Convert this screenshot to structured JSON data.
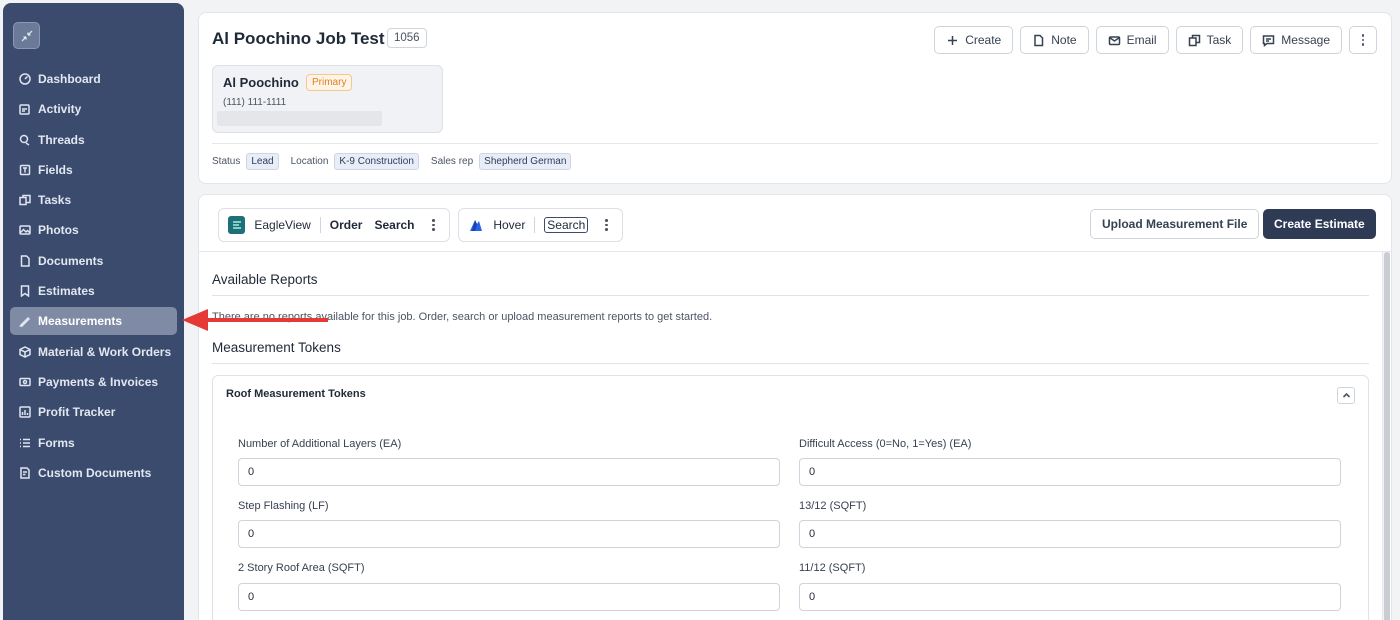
{
  "sidebar": {
    "items": [
      {
        "label": "Dashboard",
        "icon": "gauge-icon"
      },
      {
        "label": "Activity",
        "icon": "activity-icon"
      },
      {
        "label": "Threads",
        "icon": "threads-icon"
      },
      {
        "label": "Fields",
        "icon": "fields-icon"
      },
      {
        "label": "Tasks",
        "icon": "tasks-icon"
      },
      {
        "label": "Photos",
        "icon": "photo-icon"
      },
      {
        "label": "Documents",
        "icon": "document-icon"
      },
      {
        "label": "Estimates",
        "icon": "estimate-icon"
      },
      {
        "label": "Measurements",
        "icon": "ruler-icon",
        "active": true
      },
      {
        "label": "Material & Work Orders",
        "icon": "box-icon"
      },
      {
        "label": "Payments & Invoices",
        "icon": "payment-icon"
      },
      {
        "label": "Profit Tracker",
        "icon": "chart-icon"
      },
      {
        "label": "Forms",
        "icon": "list-icon"
      },
      {
        "label": "Custom Documents",
        "icon": "custom-doc-icon"
      }
    ]
  },
  "header": {
    "title": "Al Poochino Job Test",
    "job_number": "1056",
    "actions": {
      "create": "Create",
      "note": "Note",
      "email": "Email",
      "task": "Task",
      "message": "Message"
    },
    "contact": {
      "name": "Al Poochino",
      "badge": "Primary",
      "phone": "(111) 111-1111"
    },
    "meta": {
      "status_label": "Status",
      "status_value": "Lead",
      "location_label": "Location",
      "location_value": "K-9 Construction",
      "salesrep_label": "Sales rep",
      "salesrep_value": "Shepherd German"
    }
  },
  "toolbar": {
    "eagleview": {
      "name": "EagleView",
      "order": "Order",
      "search": "Search"
    },
    "hover": {
      "name": "Hover",
      "search": "Search"
    },
    "upload": "Upload Measurement File",
    "create_estimate": "Create Estimate"
  },
  "reports": {
    "title": "Available Reports",
    "empty": "There are no reports available for this job. Order, search or upload measurement reports to get started."
  },
  "tokens": {
    "title": "Measurement Tokens",
    "panel_title": "Roof Measurement Tokens",
    "fields": [
      {
        "label": "Number of Additional Layers (EA)",
        "value": "0"
      },
      {
        "label": "Difficult Access (0=No, 1=Yes) (EA)",
        "value": "0"
      },
      {
        "label": "Step Flashing (LF)",
        "value": "0"
      },
      {
        "label": "13/12 (SQFT)",
        "value": "0"
      },
      {
        "label": "2 Story Roof Area (SQFT)",
        "value": "0"
      },
      {
        "label": "11/12 (SQFT)",
        "value": "0"
      }
    ]
  },
  "colors": {
    "sidebar_bg": "#3b4b6e",
    "primary_button": "#2f3b55",
    "annotation_arrow": "#e53935"
  }
}
